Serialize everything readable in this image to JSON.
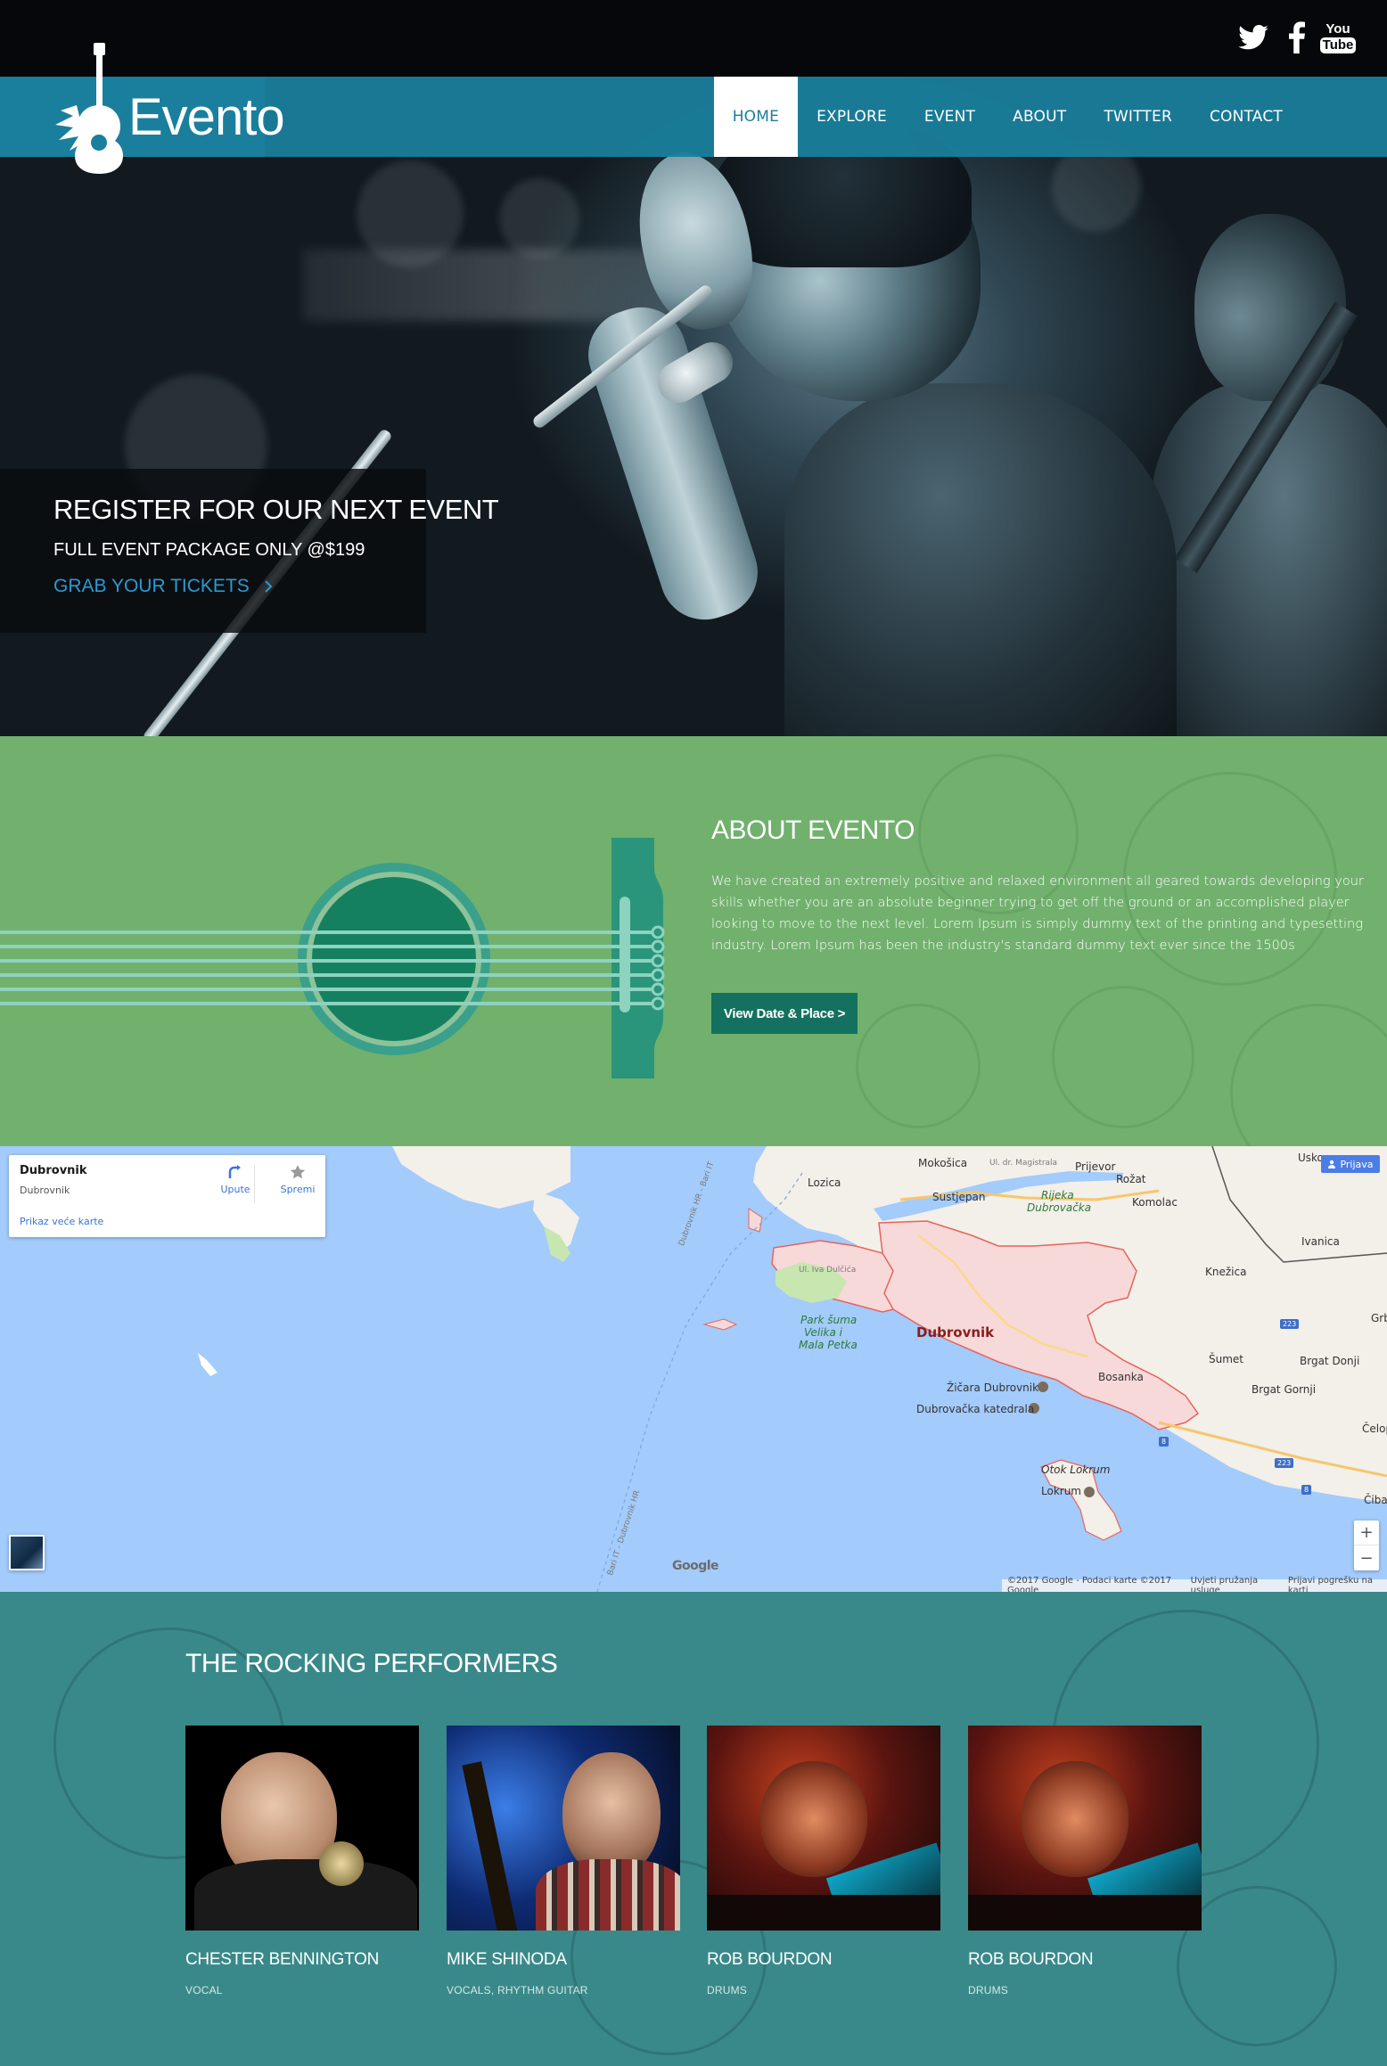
{
  "brand": {
    "name": "Evento"
  },
  "social": {
    "twitter_icon": "twitter-icon",
    "facebook_icon": "facebook-icon",
    "youtube_icon": "youtube-icon",
    "youtube_text_top": "You",
    "youtube_text_bottom": "Tube"
  },
  "nav": {
    "items": [
      {
        "label": "HOME",
        "active": true
      },
      {
        "label": "EXPLORE",
        "active": false
      },
      {
        "label": "EVENT",
        "active": false
      },
      {
        "label": "ABOUT",
        "active": false
      },
      {
        "label": "TWITTER",
        "active": false
      },
      {
        "label": "CONTACT",
        "active": false
      }
    ]
  },
  "hero": {
    "title": "REGISTER FOR OUR NEXT EVENT",
    "subtitle": "FULL EVENT PACKAGE ONLY @$199",
    "cta": "GRAB YOUR TICKETS",
    "cta_icon": "chevron-right-icon"
  },
  "about": {
    "title": "ABOUT EVENTO",
    "body": "We have created an extremely positive and relaxed environment all geared towards developing your skills whether you are an absolute beginner trying to get off the ground or an accomplished player looking to move to the next level. Lorem Ipsum is simply dummy text of the printing and typesetting industry. Lorem Ipsum has been the industry's standard dummy text ever since the 1500s",
    "button": "View Date & Place >"
  },
  "map": {
    "card": {
      "title": "Dubrovnik",
      "subtitle": "Dubrovnik",
      "directions_label": "Upute",
      "save_label": "Spremi",
      "larger_map_label": "Prikaz veće karte"
    },
    "signin_label": "Prijava",
    "zoom_in": "+",
    "zoom_out": "−",
    "logo_text": "Google",
    "footer": {
      "attribution": "©2017 Google - Podaci karte ©2017 Google",
      "terms": "Uvjeti pružanja usluge",
      "report": "Prijavi pogrešku na karti"
    },
    "places": {
      "dubrovnik": "Dubrovnik",
      "mokosica": "Mokošica",
      "prijevor": "Prijevor",
      "rozat": "Rožat",
      "lozica": "Lozica",
      "sustjepan": "Sustjepan",
      "rijeka": "Rijeka",
      "dubrovacka": "Dubrovačka",
      "komolac": "Komolac",
      "ivanica": "Ivanica",
      "knezica": "Knežica",
      "usko": "Usko",
      "gr": "Grb",
      "park1": "Park šuma",
      "park2": "Velika i",
      "park3": "Mala Petka",
      "iva_dulcica": "Ul. Iva Dulčića",
      "bosanka": "Bosanka",
      "sumet": "Šumet",
      "brgat_donji": "Brgat Donji",
      "brgat_gornji": "Brgat Gornji",
      "celopek": "Čelope",
      "zicara": "Žičara Dubrovnik",
      "katedrala": "Dubrovačka katedrala",
      "otok_lokrum": "Otok Lokrum",
      "lokrum": "Lokrum",
      "cibaca": "Čibač",
      "road_magistrala": "Ul. dr. Magistrala",
      "road_223a": "223",
      "road_223b": "223",
      "road_8a": "8",
      "road_8b": "8",
      "road_ferry": "Dubrovnik HR - Bari IT",
      "road_ferry2": "Bari IT - Dubrovnik HR"
    }
  },
  "performers": {
    "title": "THE ROCKING PERFORMERS",
    "list": [
      {
        "name": "CHESTER BENNINGTON",
        "role": "VOCAL"
      },
      {
        "name": "MIKE SHINODA",
        "role": "VOCALS, RHYTHM GUITAR"
      },
      {
        "name": "ROB BOURDON",
        "role": "DRUMS"
      },
      {
        "name": "ROB BOURDON",
        "role": "DRUMS"
      }
    ]
  }
}
